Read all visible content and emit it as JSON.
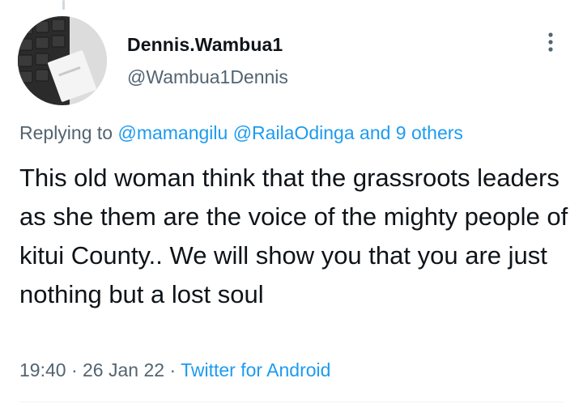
{
  "author": {
    "display_name": "Dennis.Wambua1",
    "handle": "@Wambua1Dennis",
    "avatar_icon": "keyboard-photo-avatar"
  },
  "reply": {
    "prefix": "Replying to",
    "mentions": [
      "@mamangilu",
      "@RailaOdinga"
    ],
    "others": "and 9 others"
  },
  "tweet": {
    "text": "This old woman think that the grassroots leaders as she them are the voice of the mighty people of kitui County.. We will show you that you are just nothing but a lost soul"
  },
  "meta": {
    "time": "19:40",
    "separator": "·",
    "date": "26 Jan 22",
    "source": "Twitter for Android"
  },
  "icons": {
    "more": "more-vertical-icon"
  },
  "colors": {
    "link": "#1d9bf0",
    "secondary_text": "#536471",
    "primary_text": "#0f1419"
  }
}
